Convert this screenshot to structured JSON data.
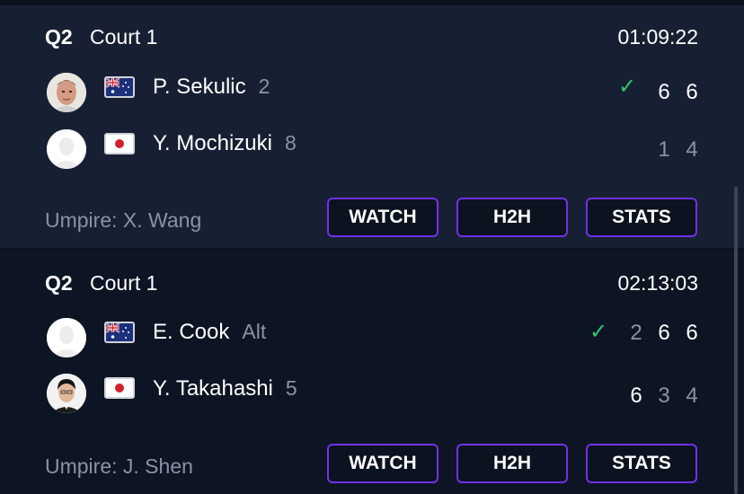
{
  "matches": [
    {
      "round": "Q2",
      "court": "Court 1",
      "time": "01:09:22",
      "players": [
        {
          "name": "P. Sekulic",
          "seed": "2",
          "flag": "australia-flag",
          "avatar": "player-photo",
          "winner": true,
          "scores": [
            "6",
            "6"
          ]
        },
        {
          "name": "Y. Mochizuki",
          "seed": "8",
          "flag": "japan-flag",
          "avatar": "placeholder-avatar",
          "winner": false,
          "scores": [
            "1",
            "4"
          ]
        }
      ],
      "umpire": "Umpire: X. Wang",
      "buttons": {
        "watch": "WATCH",
        "h2h": "H2H",
        "stats": "STATS"
      }
    },
    {
      "round": "Q2",
      "court": "Court 1",
      "time": "02:13:03",
      "players": [
        {
          "name": "E. Cook",
          "seed": "Alt",
          "flag": "australia-flag",
          "avatar": "placeholder-avatar",
          "winner": true,
          "scores": [
            "2",
            "6",
            "6"
          ]
        },
        {
          "name": "Y. Takahashi",
          "seed": "5",
          "flag": "japan-flag",
          "avatar": "player-photo",
          "winner": false,
          "scores": [
            "6",
            "3",
            "4"
          ]
        }
      ],
      "umpire": "Umpire: J. Shen",
      "buttons": {
        "watch": "WATCH",
        "h2h": "H2H",
        "stats": "STATS"
      }
    }
  ],
  "colors": {
    "accent": "#6f32e6",
    "winner_check": "#34c46e",
    "muted_text": "#8a93a3",
    "card_bg": "#172033",
    "page_bg": "#0d1524"
  },
  "icons": {
    "check": "checkmark-icon"
  }
}
